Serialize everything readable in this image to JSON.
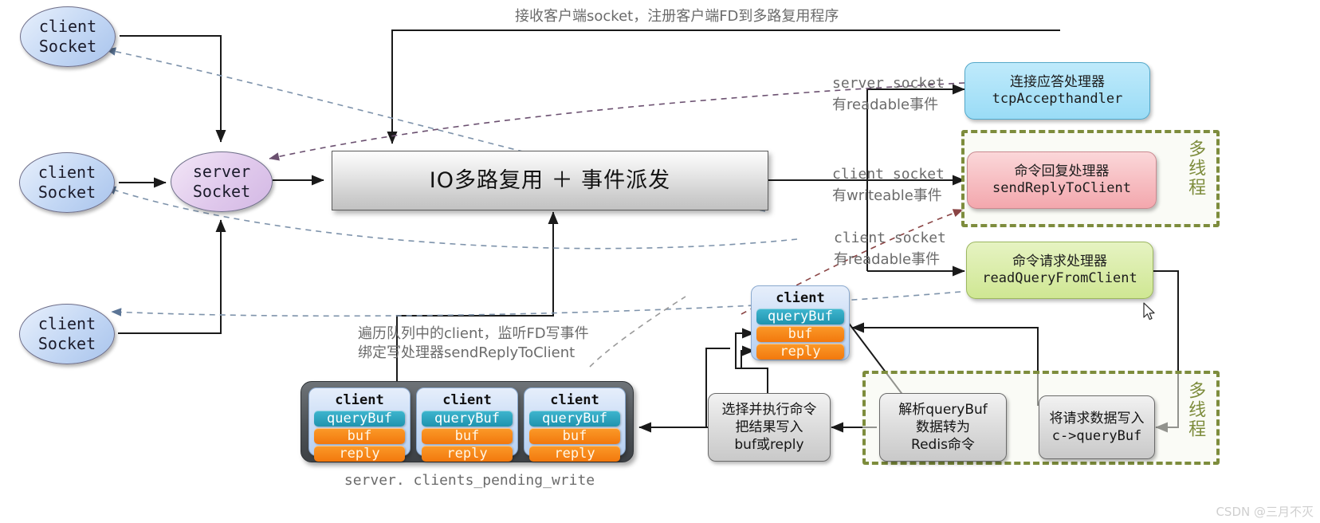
{
  "diagram": {
    "title_note_top": "接收客户端socket，注册客户端FD到多路复用程序",
    "note_below_io_line1": "遍历队列中的client，监听FD写事件",
    "note_below_io_line2": "绑定写处理器sendReplyToClient",
    "caption_pending": "server. clients_pending_write",
    "watermark": "CSDN @三月不灭"
  },
  "sockets": {
    "clients": [
      {
        "l1": "client",
        "l2": "Socket"
      },
      {
        "l1": "client",
        "l2": "Socket"
      },
      {
        "l1": "client",
        "l2": "Socket"
      }
    ],
    "server": {
      "l1": "server",
      "l2": "Socket"
    }
  },
  "io": {
    "label": "IO多路复用 ＋ 事件派发"
  },
  "event_labels": [
    {
      "line1": "server socket",
      "line2": "有readable事件"
    },
    {
      "line1": "client socket",
      "line2": "有writeable事件"
    },
    {
      "line1": "client socket",
      "line2": "有readable事件"
    }
  ],
  "handlers": [
    {
      "zh": "连接应答处理器",
      "en": "tcpAccepthandler",
      "color": "#9adcf6"
    },
    {
      "zh": "命令回复处理器",
      "en": "sendReplyToClient",
      "color": "#f3a7ad"
    },
    {
      "zh": "命令请求处理器",
      "en": "readQueryFromClient",
      "color": "#cfe793"
    }
  ],
  "multithread": {
    "label": "多线程",
    "color": "#7d8c3c"
  },
  "client_struct": {
    "title": "client",
    "fields": [
      "queryBuf",
      "buf",
      "reply"
    ]
  },
  "pending_write": {
    "clients": [
      {
        "title": "client",
        "fields": [
          "queryBuf",
          "buf",
          "reply"
        ]
      },
      {
        "title": "client",
        "fields": [
          "queryBuf",
          "buf",
          "reply"
        ]
      },
      {
        "title": "client",
        "fields": [
          "queryBuf",
          "buf",
          "reply"
        ]
      }
    ]
  },
  "process_boxes": [
    {
      "id": "exec",
      "lines": [
        "选择并执行命令",
        "把结果写入",
        "buf或reply"
      ]
    },
    {
      "id": "parse",
      "lines": [
        "解析queryBuf",
        "数据转为",
        "Redis命令"
      ]
    },
    {
      "id": "write",
      "lines": [
        "将请求数据写入",
        "c->queryBuf"
      ]
    }
  ]
}
